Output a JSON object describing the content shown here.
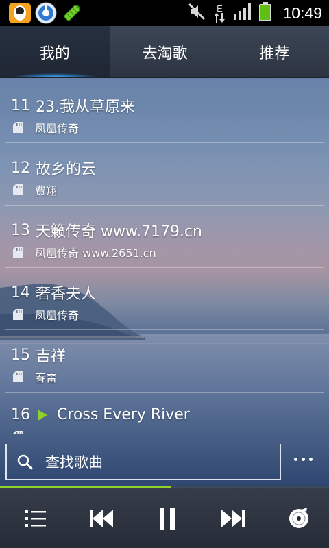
{
  "status_bar": {
    "time": "10:49",
    "left_icons": [
      "qq-penguin-icon",
      "music-app-icon",
      "battery-tool-icon"
    ],
    "right_icons": [
      "muted-icon",
      "edge-data-icon",
      "signal-icon",
      "battery-icon"
    ],
    "data_label": "E"
  },
  "tabs": [
    {
      "label": "我的",
      "active": true
    },
    {
      "label": "去淘歌",
      "active": false
    },
    {
      "label": "推荐",
      "active": false
    }
  ],
  "songs": [
    {
      "num": "11",
      "title": "23.我从草原来",
      "artist": "凤凰传奇",
      "playing": false
    },
    {
      "num": "12",
      "title": "故乡的云",
      "artist": "费翔",
      "playing": false
    },
    {
      "num": "13",
      "title": "天籁传奇 www.7179.cn",
      "artist": "凤凰传奇 www.2651.cn",
      "playing": false
    },
    {
      "num": "14",
      "title": "奢香夫人",
      "artist": "凤凰传奇",
      "playing": false
    },
    {
      "num": "15",
      "title": "吉祥",
      "artist": "春雷",
      "playing": false
    },
    {
      "num": "16",
      "title": "Cross Every River",
      "artist": "",
      "playing": true
    }
  ],
  "search": {
    "placeholder": "查找歌曲",
    "icon": "search-icon"
  },
  "more_icon": "more-dots-icon",
  "progress": {
    "fraction": 0.52,
    "color": "#8fd22c"
  },
  "player": {
    "buttons": [
      "playlist-icon",
      "previous-icon",
      "pause-icon",
      "next-icon",
      "disc-icon"
    ]
  },
  "colors": {
    "accent_green": "#8fd22c",
    "tab_glow": "#4fc6ff"
  }
}
